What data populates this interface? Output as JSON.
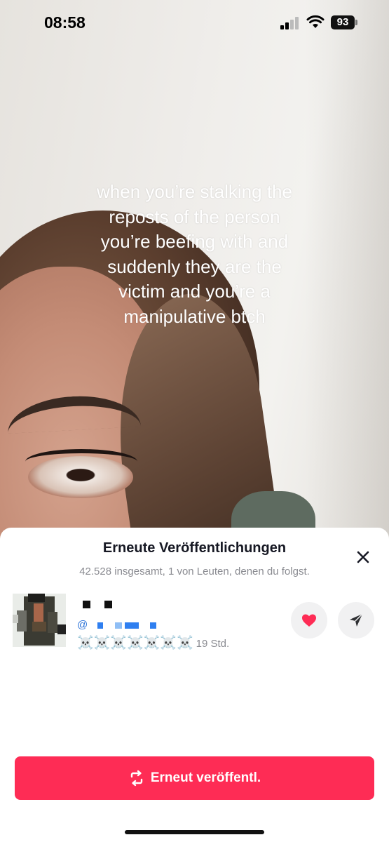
{
  "status_bar": {
    "time": "08:58",
    "battery": "93"
  },
  "video": {
    "caption": "when you’re stalking the\nreposts of the person\nyou’re beefing with and\nsuddenly they are the\nvictim and you’re a\nmanipulative btch"
  },
  "sheet": {
    "title": "Erneute Veröffentlichungen",
    "subtitle": "42.528 insgesamt, 1 von Leuten, denen du folgst.",
    "close_icon": "close-icon",
    "entry": {
      "handle_prefix": "@",
      "emojis": "☠️☠️☠️☠️☠️☠️☠️",
      "time_ago": "19 Std.",
      "like_icon": "heart-icon",
      "share_icon": "send-icon"
    },
    "repost_button": {
      "label": "Erneut veröffentl.",
      "icon": "repost-icon"
    }
  },
  "colors": {
    "accent": "#fe2c55",
    "heart": "#fe2c55",
    "handle": "#2a72d8"
  }
}
